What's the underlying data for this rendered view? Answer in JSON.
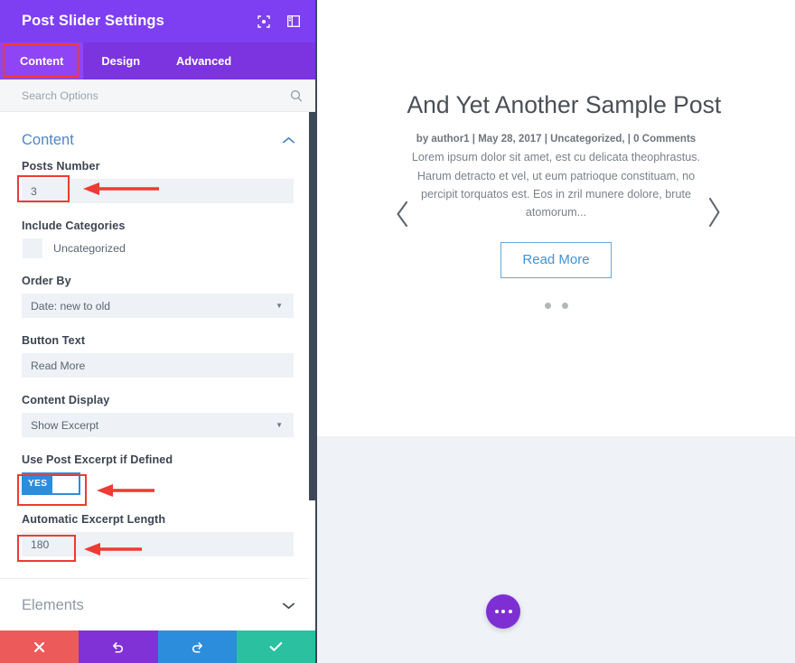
{
  "panel": {
    "title": "Post Slider Settings",
    "header_icons": [
      {
        "name": "fullscreen-icon"
      },
      {
        "name": "layout-panel-icon"
      }
    ],
    "tabs": [
      {
        "label": "Content",
        "active": true
      },
      {
        "label": "Design",
        "active": false
      },
      {
        "label": "Advanced",
        "active": false
      }
    ],
    "search": {
      "placeholder": "Search Options",
      "value": ""
    },
    "sections": [
      {
        "title": "Content",
        "expanded": true
      },
      {
        "title": "Elements",
        "expanded": false
      }
    ],
    "fields": {
      "posts_number": {
        "label": "Posts Number",
        "value": "3"
      },
      "include_categories": {
        "label": "Include Categories",
        "options": [
          {
            "label": "Uncategorized",
            "checked": false
          }
        ]
      },
      "order_by": {
        "label": "Order By",
        "value": "Date: new to old"
      },
      "button_text": {
        "label": "Button Text",
        "value": "Read More"
      },
      "content_display": {
        "label": "Content Display",
        "value": "Show Excerpt"
      },
      "use_post_excerpt": {
        "label": "Use Post Excerpt if Defined",
        "value": "YES"
      },
      "excerpt_length": {
        "label": "Automatic Excerpt Length",
        "value": "180"
      }
    },
    "footer_buttons": [
      {
        "name": "cancel-button",
        "icon": "close-icon"
      },
      {
        "name": "undo-button",
        "icon": "undo-icon"
      },
      {
        "name": "redo-button",
        "icon": "redo-icon"
      },
      {
        "name": "save-button",
        "icon": "check-icon"
      }
    ]
  },
  "preview": {
    "slide": {
      "title": "And Yet Another Sample Post",
      "meta": "by author1  |  May 28, 2017  |  Uncategorized,  |  0 Comments",
      "excerpt": "Lorem ipsum dolor sit amet, est cu delicata theophrastus. Harum detracto et vel, ut eum patrioque constituam, no percipit torquatos est. Eos in zril munere dolore, brute atomorum...",
      "button_label": "Read More"
    },
    "dots_count": 2,
    "prev_arrow": "‹",
    "next_arrow": "›"
  },
  "colors": {
    "brand_purple": "#7e3ff2",
    "tab_bar": "#7b34e0",
    "tab_active": "#8f45f5",
    "highlight_red": "#ee3b33",
    "toggle_blue": "#2d8ddd",
    "link_blue": "#4c86c6",
    "cancel_red": "#ed5a5a",
    "undo_purple": "#8132d6",
    "redo_blue": "#2d8ddd",
    "save_green": "#2bc1a0"
  }
}
